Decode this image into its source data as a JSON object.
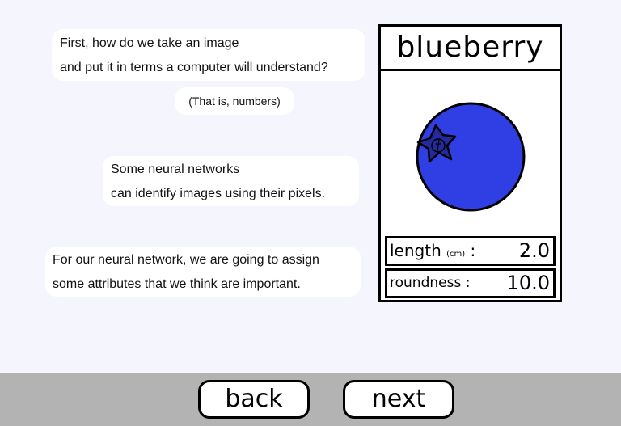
{
  "lesson": {
    "intro_line1": "First, how do we take an image",
    "intro_line2": "and put it in terms a computer will understand?",
    "aside": "(That is, numbers)",
    "pixels_line1": "Some neural networks",
    "pixels_line2": "can identify images using their pixels.",
    "attributes_line1": "For our neural network, we are going to assign",
    "attributes_line2": "some attributes that we think are important."
  },
  "card": {
    "title": "blueberry",
    "image_icon": "blueberry-icon",
    "colors": {
      "berry_fill": "#2f3fe3",
      "crown_fill": "#232a9c",
      "outline": "#000000"
    },
    "attributes": [
      {
        "label": "length",
        "unit": "(cm)",
        "separator": ":",
        "value": "2.0"
      },
      {
        "label": "roundness",
        "unit": "",
        "separator": ":",
        "value": "10.0"
      }
    ]
  },
  "nav": {
    "back_label": "back",
    "next_label": "next",
    "bar_color": "#b3b3b3"
  }
}
